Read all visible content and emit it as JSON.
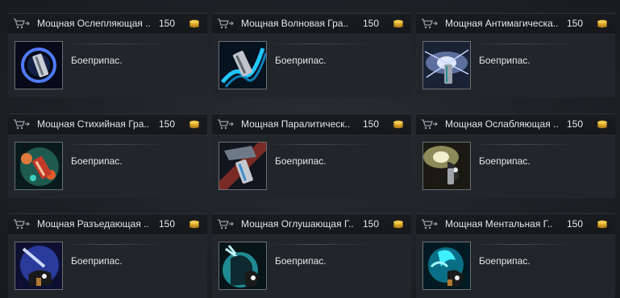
{
  "items": [
    {
      "title": "Мощная Ослепляющая ..",
      "price": "150",
      "description": "Боеприпас.",
      "icon": "blinding-ammo-icon"
    },
    {
      "title": "Мощная Волновая Гра..",
      "price": "150",
      "description": "Боеприпас.",
      "icon": "wave-ammo-icon"
    },
    {
      "title": "Мощная Антимагическа..",
      "price": "150",
      "description": "Боеприпас.",
      "icon": "antimagic-ammo-icon"
    },
    {
      "title": "Мощная Стихийная Гра..",
      "price": "150",
      "description": "Боеприпас.",
      "icon": "elemental-ammo-icon"
    },
    {
      "title": "Мощная Паралитическ..",
      "price": "150",
      "description": "Боеприпас.",
      "icon": "paralytic-ammo-icon"
    },
    {
      "title": "Мощная Ослабляющая ..",
      "price": "150",
      "description": "Боеприпас.",
      "icon": "weakening-ammo-icon"
    },
    {
      "title": "Мощная Разъедающая ..",
      "price": "150",
      "description": "Боеприпас.",
      "icon": "corrosive-ammo-icon"
    },
    {
      "title": "Мощная Оглушающая Г..",
      "price": "150",
      "description": "Боеприпас.",
      "icon": "stunning-ammo-icon"
    },
    {
      "title": "Мощная Ментальная Г..",
      "price": "150",
      "description": "Боеприпас.",
      "icon": "mental-ammo-icon"
    }
  ]
}
